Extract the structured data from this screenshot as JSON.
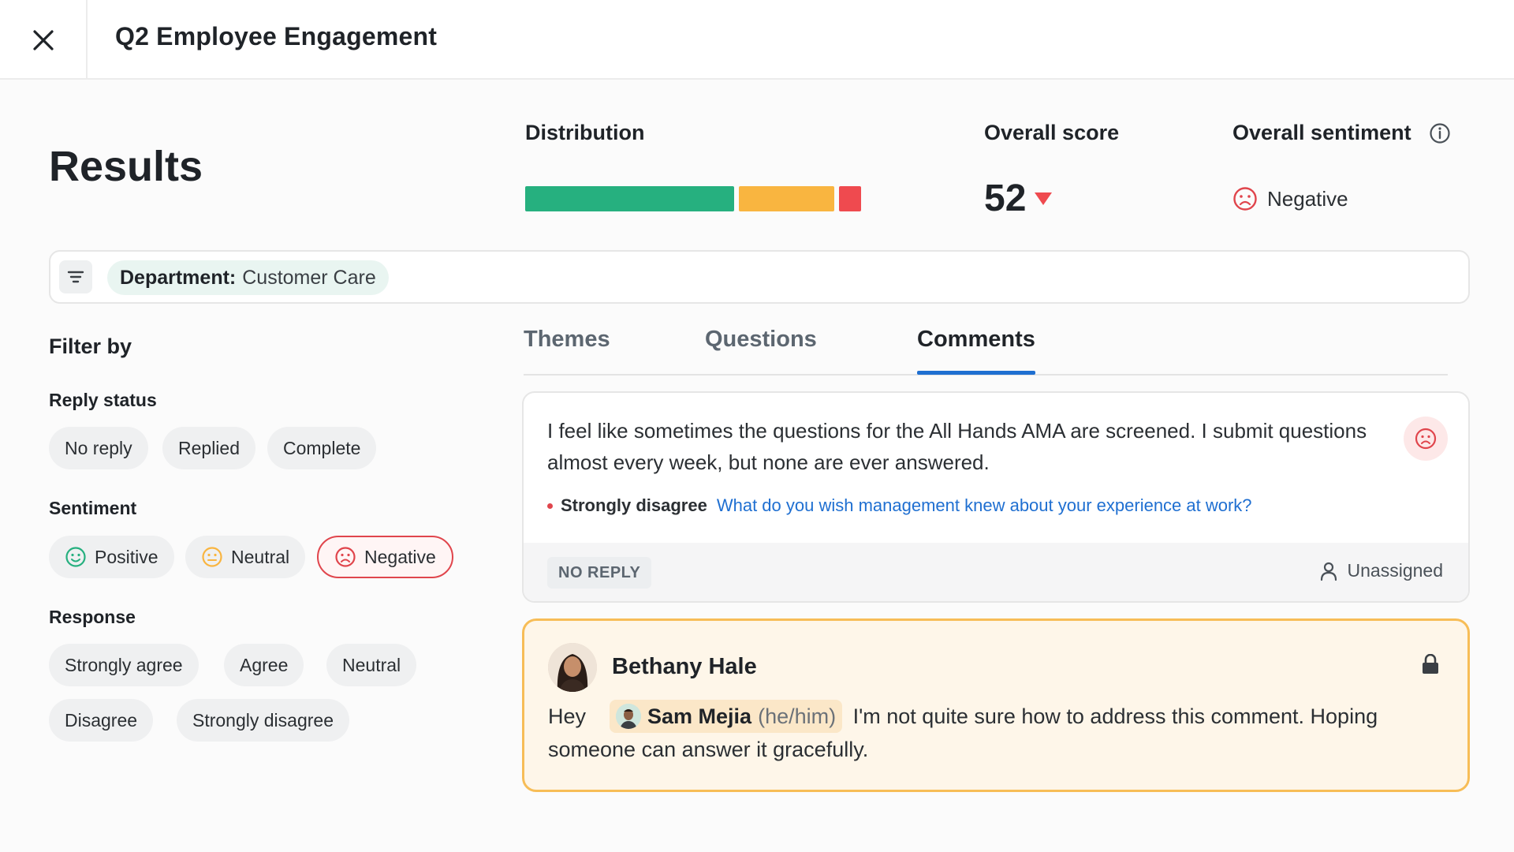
{
  "header": {
    "title": "Q2 Employee Engagement"
  },
  "results": {
    "title": "Results",
    "distribution_label": "Distribution",
    "distribution": [
      {
        "share": 0.625,
        "color": "#26b07f"
      },
      {
        "share": 0.285,
        "color": "#f9b540"
      },
      {
        "share": 0.065,
        "color": "#ef4a4f"
      }
    ],
    "score_label": "Overall score",
    "score_value": "52",
    "score_trend": "down",
    "sentiment_label": "Overall sentiment",
    "sentiment_value": "Negative"
  },
  "filter_bar": {
    "chip_key": "Department:",
    "chip_value": "Customer Care"
  },
  "filters": {
    "title": "Filter by",
    "reply_status": {
      "label": "Reply status",
      "options": [
        "No reply",
        "Replied",
        "Complete"
      ]
    },
    "sentiment": {
      "label": "Sentiment",
      "options": [
        "Positive",
        "Neutral",
        "Negative"
      ],
      "selected": "Negative"
    },
    "response": {
      "label": "Response",
      "options": [
        "Strongly agree",
        "Agree",
        "Neutral",
        "Disagree",
        "Strongly disagree"
      ]
    }
  },
  "tabs": {
    "items": [
      "Themes",
      "Questions",
      "Comments"
    ],
    "active": "Comments"
  },
  "comment": {
    "text": "I feel like sometimes the questions for the All Hands AMA are screened. I submit questions almost every week, but none are ever answered.",
    "response": "Strongly disagree",
    "question": "What do you wish management knew about your experience at work?",
    "status": "NO REPLY",
    "assignee": "Unassigned"
  },
  "reply": {
    "author": "Bethany Hale",
    "greeting": "Hey",
    "mention_name": "Sam Mejia",
    "mention_pronoun": "(he/him)",
    "text": "I'm not quite sure how to address this comment. Hoping someone can answer it gracefully."
  },
  "colors": {
    "positive": "#26b07f",
    "neutral": "#f9b540",
    "negative": "#e0454c",
    "link": "#1f6fd1",
    "reply_border": "#f7bd57"
  }
}
